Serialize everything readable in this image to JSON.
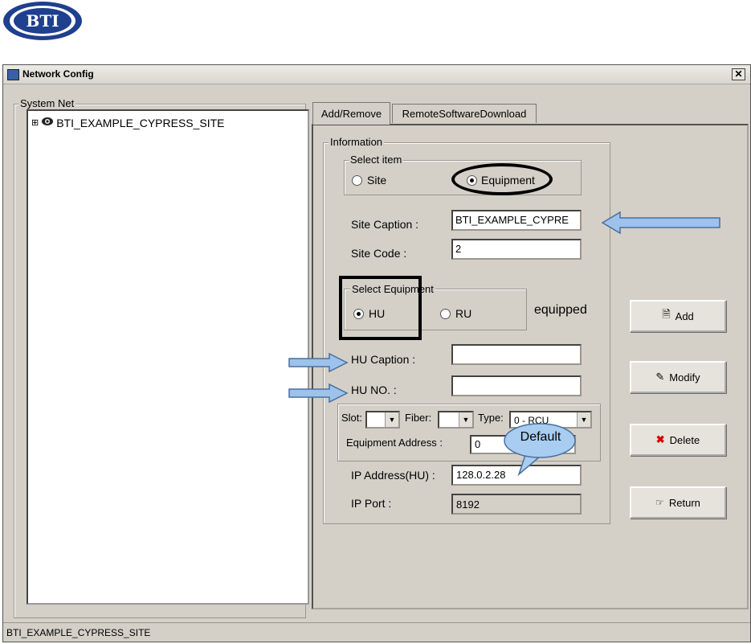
{
  "logo": {
    "text": "BTI"
  },
  "window": {
    "title": "Network Config",
    "close_glyph": "✕"
  },
  "system_net": {
    "label": "System Net",
    "tree": [
      {
        "expander": "⊞",
        "label": "BTI_EXAMPLE_CYPRESS_SITE"
      }
    ]
  },
  "tabs": [
    {
      "label": "Add/Remove",
      "active": true
    },
    {
      "label": "RemoteSoftwareDownload",
      "active": false
    }
  ],
  "information": {
    "label": "Information",
    "select_item": {
      "label": "Select item",
      "options": [
        {
          "label": "Site",
          "selected": false
        },
        {
          "label": "Equipment",
          "selected": true
        }
      ]
    },
    "site_caption": {
      "label": "Site Caption :",
      "value": "BTI_EXAMPLE_CYPRE"
    },
    "site_code": {
      "label": "Site Code :",
      "value": "2"
    },
    "select_equipment": {
      "label": "Select Equipment",
      "options": [
        {
          "label": "HU",
          "selected": true
        },
        {
          "label": "RU",
          "selected": false
        }
      ]
    },
    "equipped_text": "equipped",
    "hu_caption": {
      "label": "HU Caption :",
      "value": ""
    },
    "hu_no": {
      "label": "HU NO. :",
      "value": ""
    },
    "slot": {
      "label": "Slot:",
      "value": ""
    },
    "fiber": {
      "label": "Fiber:",
      "value": ""
    },
    "type": {
      "label": "Type:",
      "value": "0 - RCU"
    },
    "equipment_address": {
      "label": "Equipment Address :",
      "value": "0"
    },
    "ip_address": {
      "label": "IP Address(HU) :",
      "value": "128.0.2.28"
    },
    "ip_port": {
      "label": "IP Port :",
      "value": "8192"
    }
  },
  "callout": {
    "text": "Default"
  },
  "buttons": {
    "add": "Add",
    "modify": "Modify",
    "delete": "Delete",
    "return": "Return"
  },
  "status_bar": {
    "text": "BTI_EXAMPLE_CYPRESS_SITE"
  },
  "colors": {
    "arrow_fill": "#9dc3ec",
    "arrow_stroke": "#4a6fa0",
    "callout_fill": "#a9cdf0",
    "highlight": "#000000",
    "logo_blue": "#1f3f8f"
  }
}
